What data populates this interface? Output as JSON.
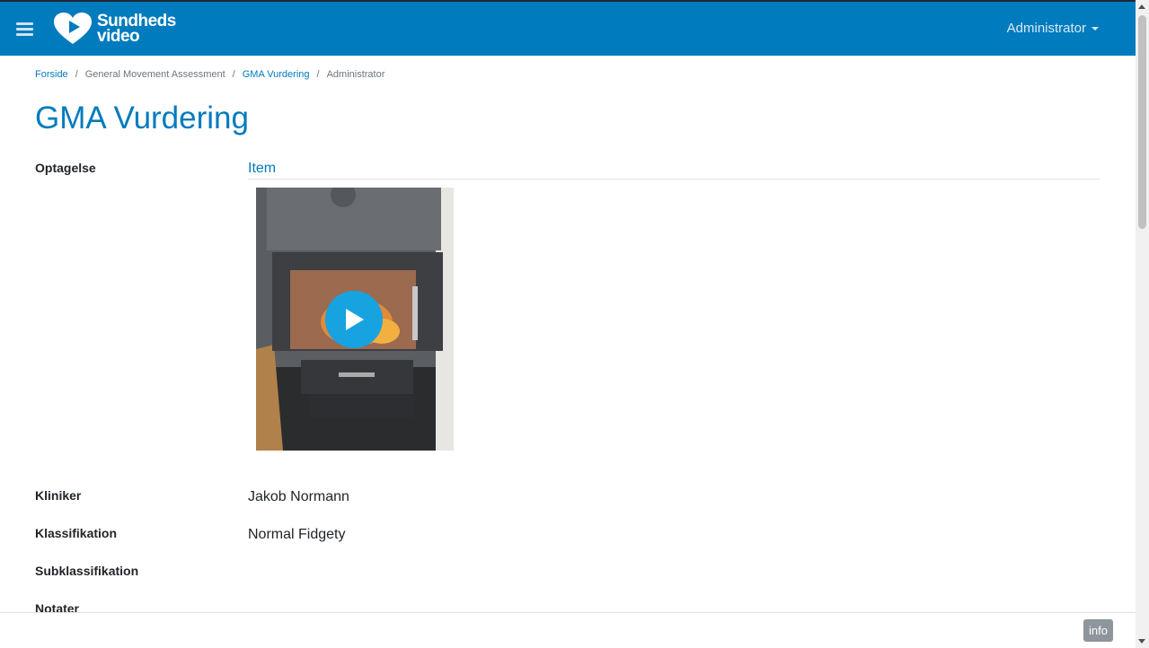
{
  "header": {
    "logo_line1": "Sundheds",
    "logo_line2": "video",
    "user_menu_label": "Administrator"
  },
  "breadcrumb": {
    "items": [
      "Forside",
      "General Movement Assessment",
      "GMA Vurdering",
      "Administrator"
    ]
  },
  "page": {
    "title": "GMA Vurdering"
  },
  "details": {
    "recording_label": "Optagelse",
    "recording_tab": "Item",
    "clinician_label": "Kliniker",
    "clinician_value": "Jakob Normann",
    "classification_label": "Klassifikation",
    "classification_value": "Normal Fidgety",
    "subclassification_label": "Subklassifikation",
    "notes_label": "Notater"
  },
  "footer": {
    "info_label": "info"
  },
  "colors": {
    "brand": "#007bbd",
    "play_button": "#16a3e0"
  },
  "icons": [
    "hamburger-icon",
    "heart-play-logo-icon",
    "caret-down-icon",
    "play-icon"
  ]
}
